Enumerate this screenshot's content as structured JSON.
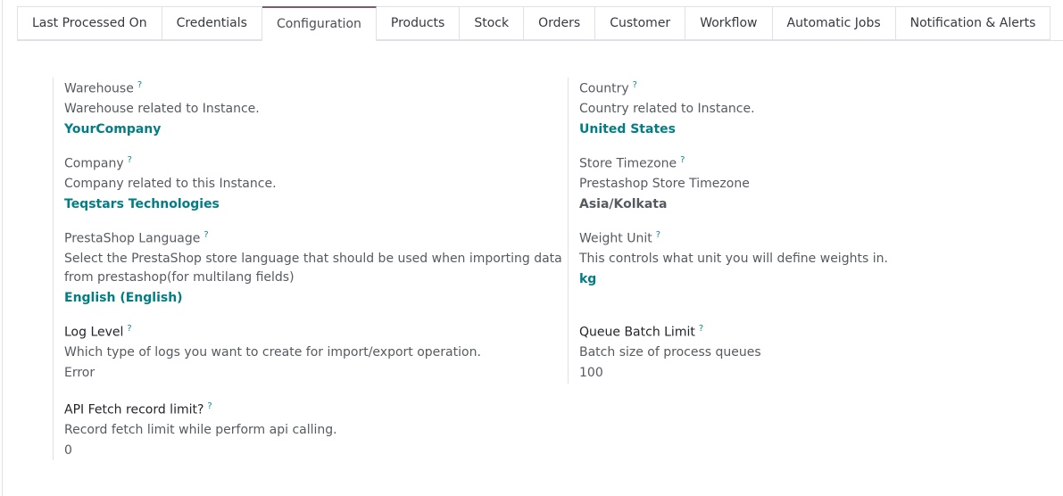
{
  "tabs": [
    {
      "label": "Last Processed On"
    },
    {
      "label": "Credentials"
    },
    {
      "label": "Configuration"
    },
    {
      "label": "Products"
    },
    {
      "label": "Stock"
    },
    {
      "label": "Orders"
    },
    {
      "label": "Customer"
    },
    {
      "label": "Workflow"
    },
    {
      "label": "Automatic Jobs"
    },
    {
      "label": "Notification & Alerts"
    }
  ],
  "active_tab": "Configuration",
  "help_marker": "?",
  "fields": {
    "warehouse": {
      "label": "Warehouse",
      "help": "Warehouse related to Instance.",
      "value": "YourCompany"
    },
    "company": {
      "label": "Company",
      "help": "Company related to this Instance.",
      "value": "Teqstars Technologies"
    },
    "language": {
      "label": "PrestaShop Language",
      "help_line1": "Select the PrestaShop store language that should be used when importing data",
      "help_line2": "from prestashop(for multilang fields)",
      "value": "English (English)"
    },
    "log_level": {
      "label": "Log Level",
      "help": "Which type of logs you want to create for import/export operation.",
      "value": "Error"
    },
    "api_limit": {
      "label": "API Fetch record limit?",
      "help": "Record fetch limit while perform api calling.",
      "value": "0"
    },
    "country": {
      "label": "Country",
      "help": "Country related to Instance.",
      "value": "United States"
    },
    "timezone": {
      "label": "Store Timezone",
      "help": "Prestashop Store Timezone",
      "value": "Asia/Kolkata"
    },
    "weight_unit": {
      "label": "Weight Unit",
      "help": "This controls what unit you will define weights in.",
      "value": "kg"
    },
    "queue_limit": {
      "label": "Queue Batch Limit",
      "help": "Batch size of process queues",
      "value": "100"
    }
  },
  "colors": {
    "link": "#017e84",
    "active_tab_border": "#7e5a6e"
  }
}
